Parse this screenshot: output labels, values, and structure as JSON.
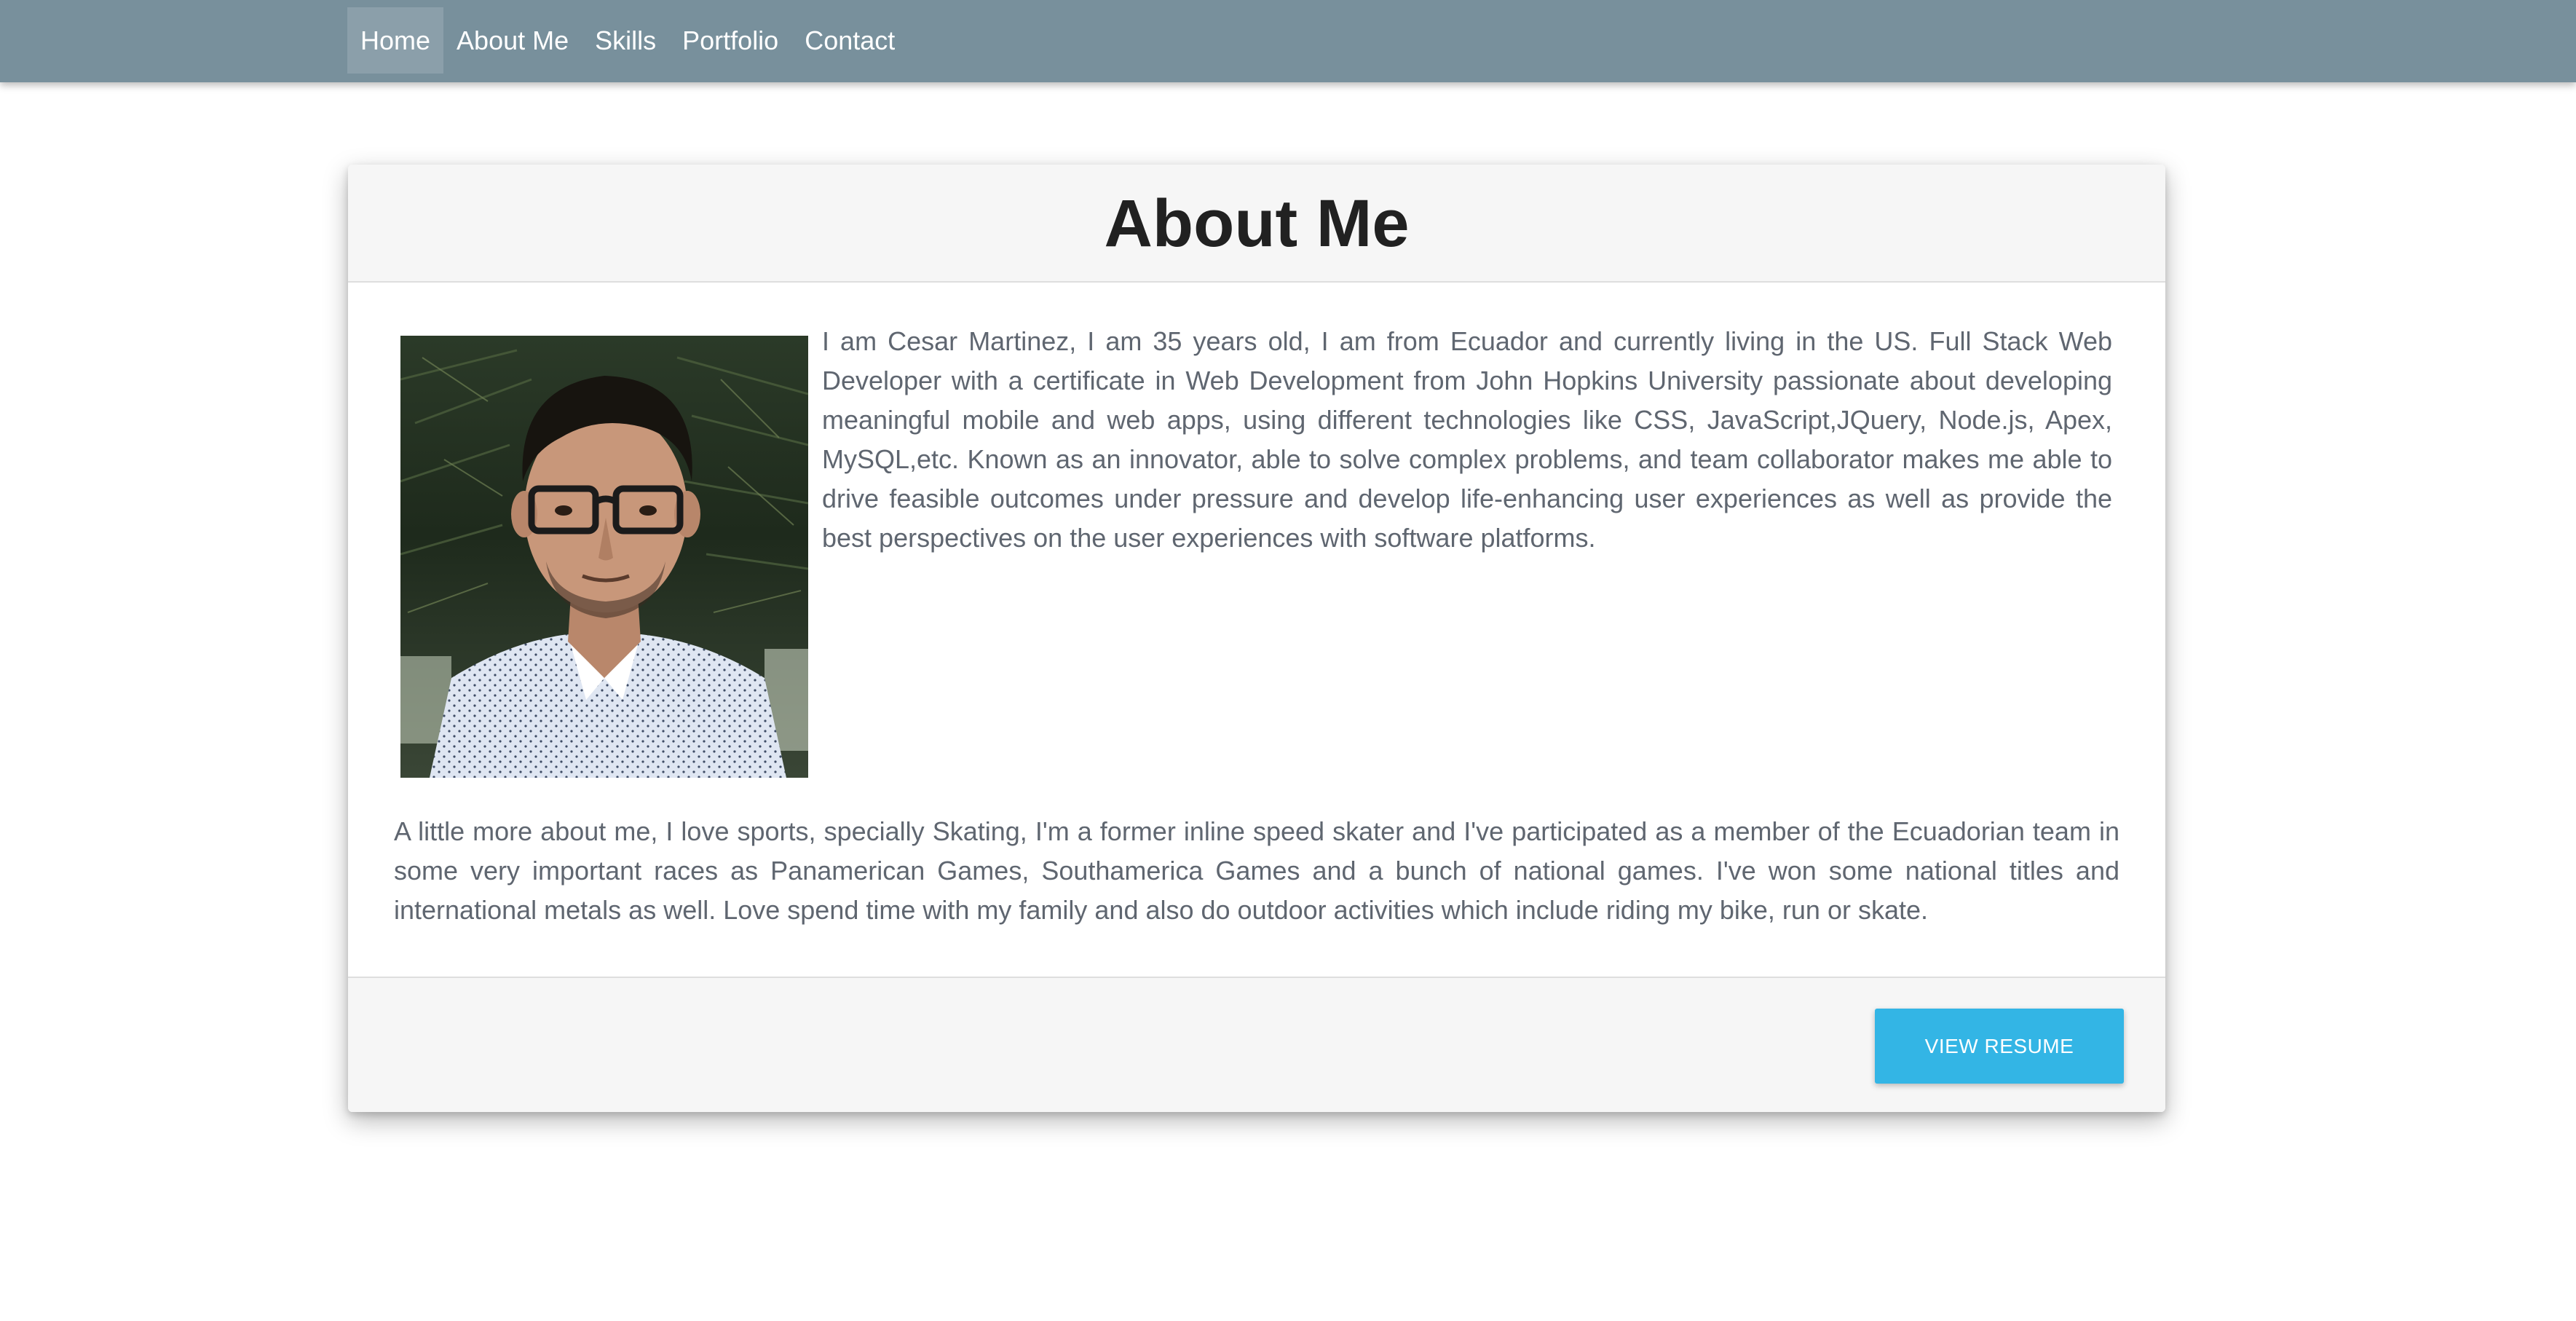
{
  "nav": {
    "items": [
      {
        "label": "Home",
        "active": true
      },
      {
        "label": "About Me",
        "active": false
      },
      {
        "label": "Skills",
        "active": false
      },
      {
        "label": "Portfolio",
        "active": false
      },
      {
        "label": "Contact",
        "active": false
      }
    ]
  },
  "about": {
    "title": "About Me",
    "photo_alt": "portrait-photo",
    "paragraph1": "I am Cesar Martinez, I am 35 years old, I am from Ecuador and currently living in the US. Full Stack Web Developer with a certificate in Web Development from John Hopkins University passionate about developing meaningful mobile and web apps, using different technologies like CSS, JavaScript,JQuery, Node.js, Apex, MySQL,etc. Known as an innovator, able to solve complex problems, and team collaborator makes me able to drive feasible outcomes under pressure and develop life-enhancing user experiences as well as provide the best perspectives on the user experiences with software platforms.",
    "paragraph2": "A little more about me, I love sports, specially Skating, I'm a former inline speed skater and I've participated as a member of the Ecuadorian team in some very important races as Panamerican Games, Southamerica Games and a bunch of national games. I've won some national titles and international metals as well. Love spend time with my family and also do outdoor activities which include riding my bike, run or skate.",
    "resume_button": "VIEW RESUME"
  },
  "colors": {
    "navbar": "#78909c",
    "button": "#33b5e5",
    "body_text": "#5f6670",
    "title_text": "#212121"
  }
}
